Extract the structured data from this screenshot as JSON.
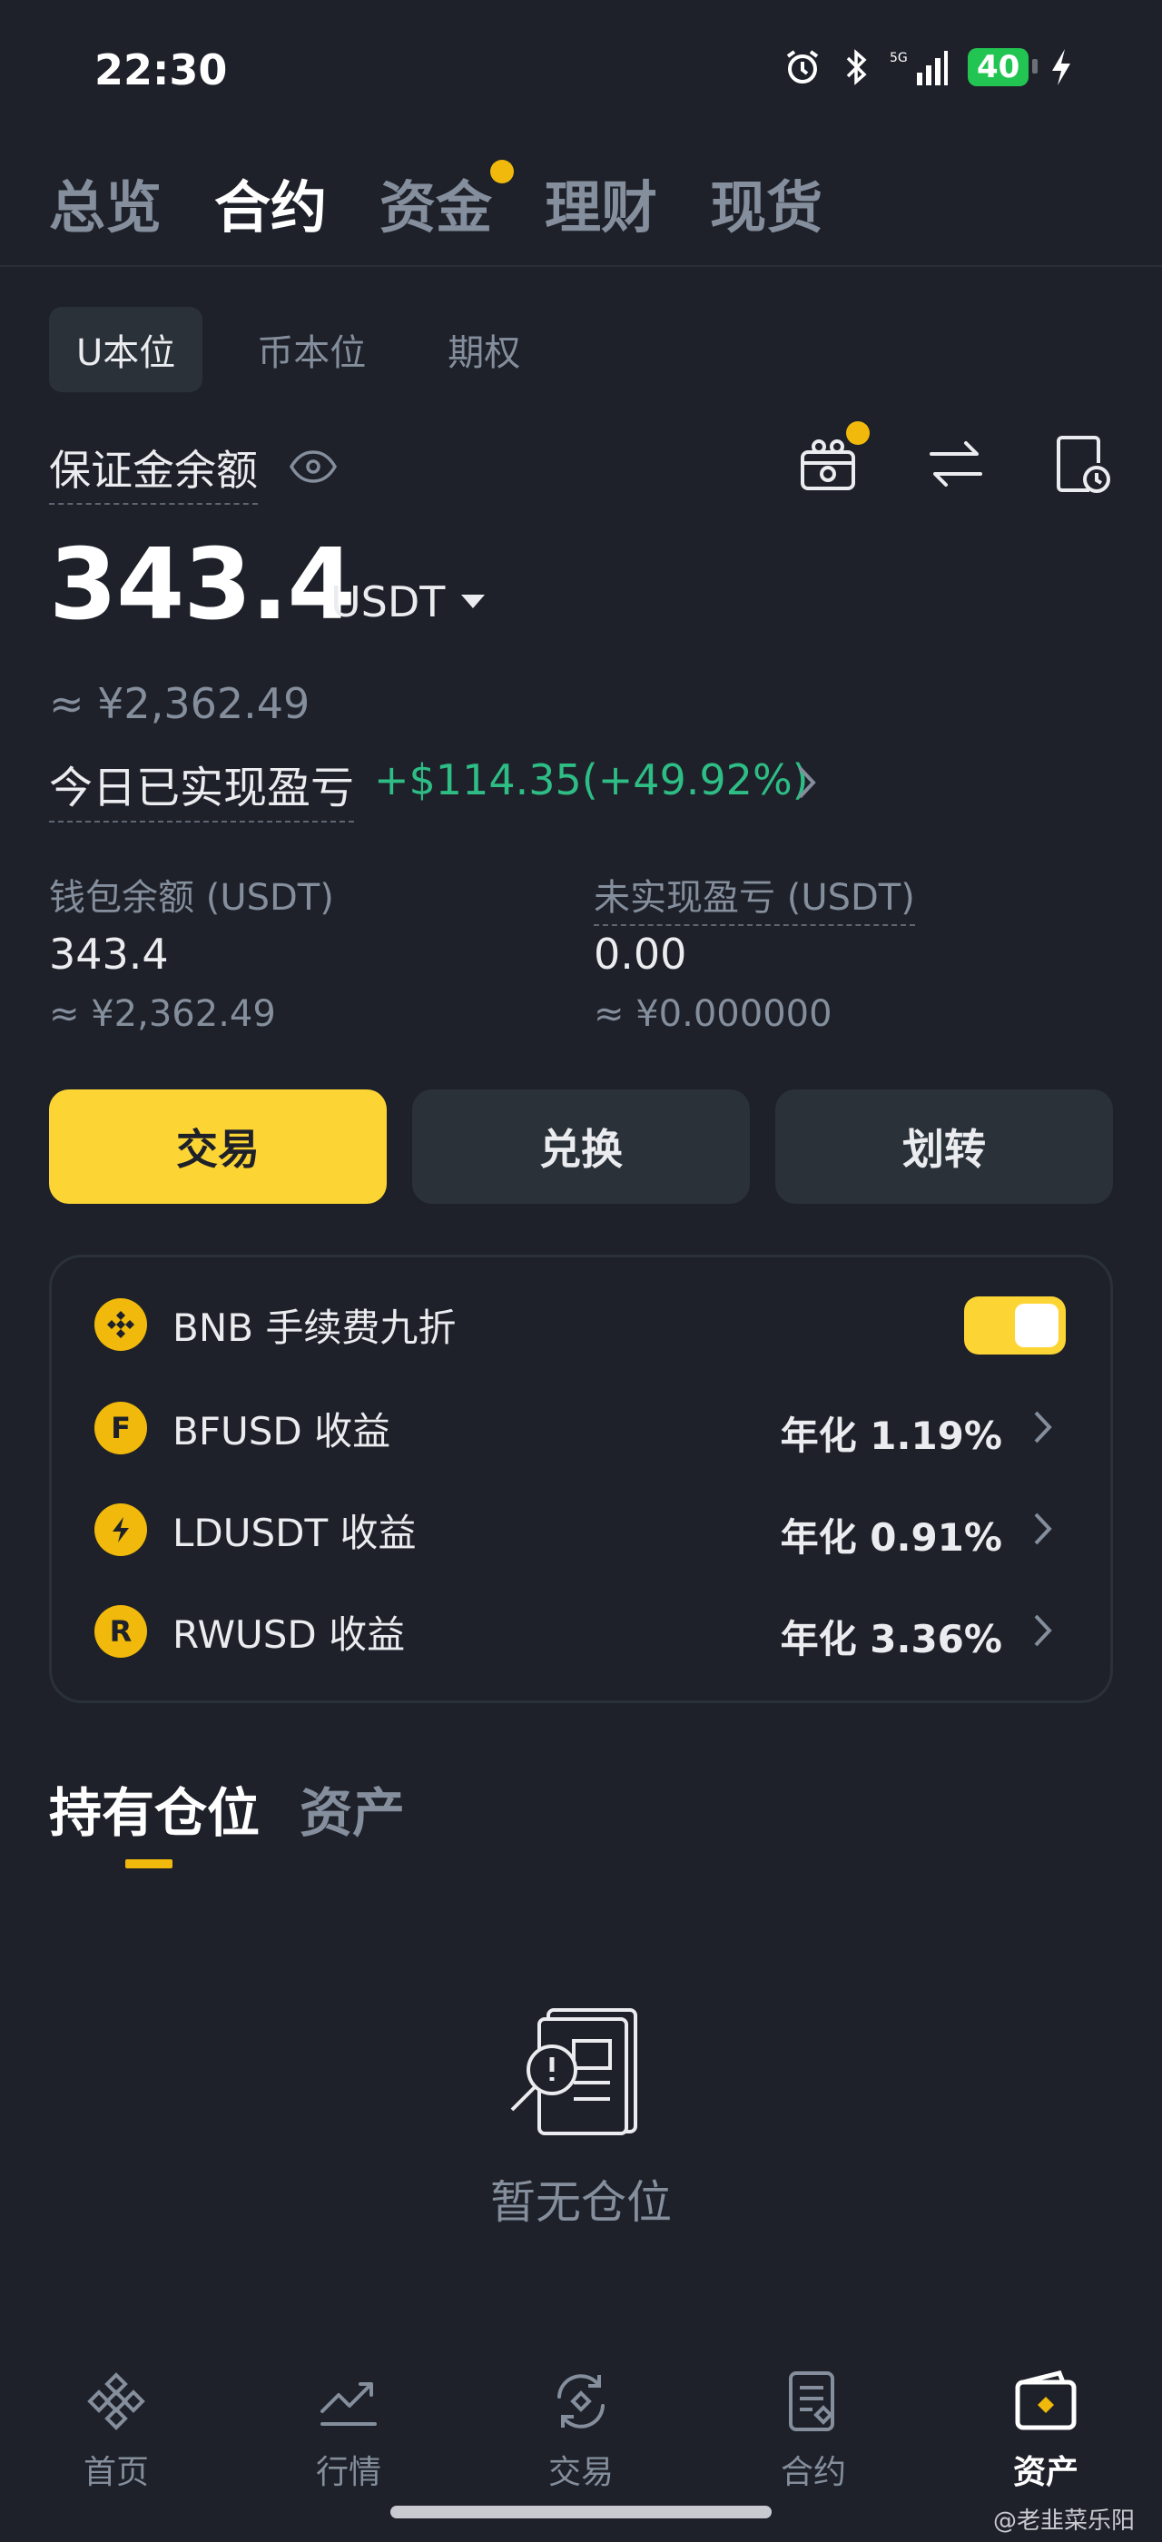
{
  "status_bar": {
    "time": "22:30",
    "battery": "40",
    "network": "5G"
  },
  "top_tabs": [
    {
      "label": "总览"
    },
    {
      "label": "合约"
    },
    {
      "label": "资金"
    },
    {
      "label": "理财"
    },
    {
      "label": "现货"
    }
  ],
  "sub_tabs": [
    {
      "label": "U本位"
    },
    {
      "label": "币本位"
    },
    {
      "label": "期权"
    }
  ],
  "balance": {
    "label": "保证金余额",
    "amount": "343.4",
    "unit": "USDT",
    "approx": "≈ ¥2,362.49",
    "pnl_label": "今日已实现盈亏",
    "pnl_value": "+$114.35(+49.92%)"
  },
  "wallet": {
    "label": "钱包余额 (USDT)",
    "value": "343.4",
    "approx": "≈ ¥2,362.49"
  },
  "unrealized": {
    "label": "未实现盈亏 (USDT)",
    "value": "0.00",
    "approx": "≈ ¥0.000000"
  },
  "actions": {
    "trade": "交易",
    "convert": "兑换",
    "transfer": "划转"
  },
  "earn_card": {
    "bnb_label": "BNB 手续费九折",
    "bnb_enabled": true,
    "rows": [
      {
        "label": "BFUSD 收益",
        "rate": "年化 1.19%",
        "icon": "bfusd-coin-icon"
      },
      {
        "label": "LDUSDT 收益",
        "rate": "年化 0.91%",
        "icon": "ldusdt-coin-icon"
      },
      {
        "label": "RWUSD 收益",
        "rate": "年化 3.36%",
        "icon": "rwusd-coin-icon"
      }
    ]
  },
  "position_tabs": {
    "holdings": "持有仓位",
    "assets": "资产"
  },
  "empty_state": "暂无仓位",
  "bottom_nav": [
    {
      "label": "首页",
      "icon": "home-icon"
    },
    {
      "label": "行情",
      "icon": "chart-icon"
    },
    {
      "label": "交易",
      "icon": "trade-icon"
    },
    {
      "label": "合约",
      "icon": "futures-icon"
    },
    {
      "label": "资产",
      "icon": "wallet-icon"
    }
  ],
  "watermark": "@老韭菜乐阳",
  "colors": {
    "accent": "#fcd535",
    "positive": "#2ebd85",
    "background": "#1e2129"
  }
}
